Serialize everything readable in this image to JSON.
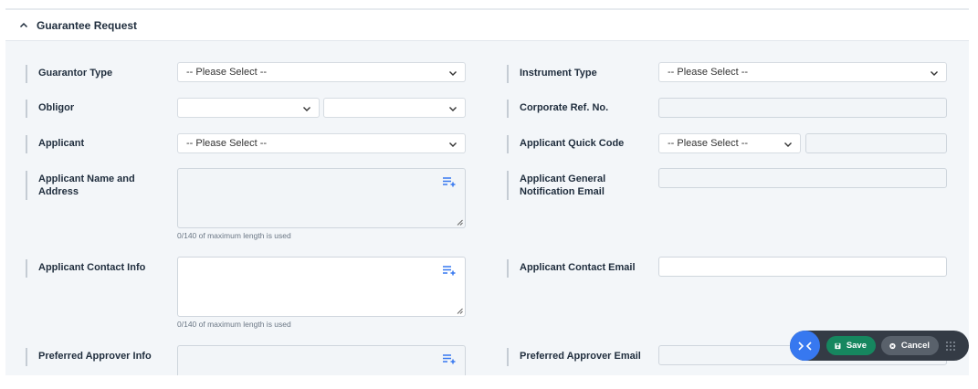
{
  "section": {
    "title": "Guarantee Request"
  },
  "fields": {
    "guarantor_type": {
      "label": "Guarantor Type",
      "value": "-- Please Select --"
    },
    "instrument_type": {
      "label": "Instrument Type",
      "value": "-- Please Select --"
    },
    "obligor": {
      "label": "Obligor",
      "value_1": "",
      "value_2": ""
    },
    "corporate_ref": {
      "label": "Corporate Ref. No.",
      "value": ""
    },
    "applicant": {
      "label": "Applicant",
      "value": "-- Please Select --"
    },
    "applicant_quick_code": {
      "label": "Applicant Quick Code",
      "value": "-- Please Select --",
      "text_value": ""
    },
    "applicant_name_address": {
      "label": "Applicant Name and Address",
      "value": "",
      "counter": "0/140 of maximum length is used"
    },
    "applicant_general_email": {
      "label": "Applicant General Notification Email",
      "value": ""
    },
    "applicant_contact_info": {
      "label": "Applicant Contact Info",
      "value": "",
      "counter": "0/140 of maximum length is used"
    },
    "applicant_contact_email": {
      "label": "Applicant Contact Email",
      "value": ""
    },
    "preferred_approver_info": {
      "label": "Preferred Approver Info",
      "value": ""
    },
    "preferred_approver_email": {
      "label": "Preferred Approver Email",
      "value": ""
    }
  },
  "actions": {
    "save_label": "Save",
    "cancel_label": "Cancel"
  },
  "colors": {
    "accent": "#3778f0",
    "save": "#16875f",
    "cancel": "#59616b",
    "toolbar": "#343b45"
  }
}
